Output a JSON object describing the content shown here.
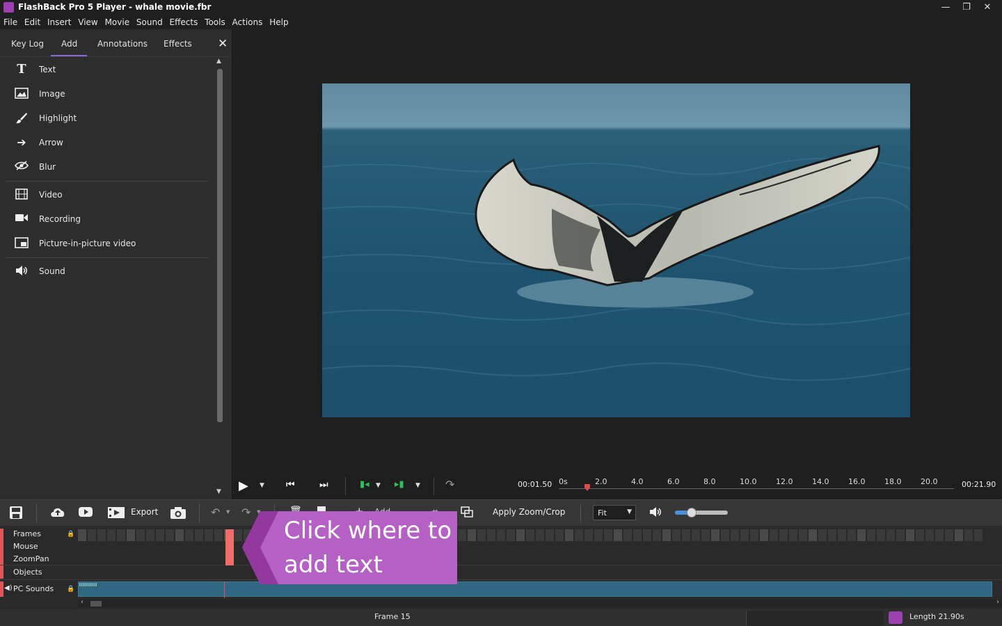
{
  "window": {
    "title": "FlashBack Pro 5 Player - whale movie.fbr"
  },
  "menu": [
    "File",
    "Edit",
    "Insert",
    "View",
    "Movie",
    "Sound",
    "Effects",
    "Tools",
    "Actions",
    "Help"
  ],
  "panel": {
    "tabs": [
      "Key Log",
      "Add",
      "Annotations",
      "Effects"
    ],
    "active_tab": "Add",
    "items": [
      {
        "label": "Text",
        "icon": "text-icon"
      },
      {
        "label": "Image",
        "icon": "image-icon"
      },
      {
        "label": "Highlight",
        "icon": "brush-icon"
      },
      {
        "label": "Arrow",
        "icon": "arrow-icon"
      },
      {
        "label": "Blur",
        "icon": "blur-icon"
      },
      {
        "label": "Video",
        "icon": "film-icon"
      },
      {
        "label": "Recording",
        "icon": "camera-icon"
      },
      {
        "label": "Picture-in-picture video",
        "icon": "pip-icon"
      },
      {
        "label": "Sound",
        "icon": "speaker-icon"
      }
    ]
  },
  "transport": {
    "current_time": "00:01.50",
    "total_time": "00:21.90",
    "ticks": [
      "0s",
      "2.0",
      "4.0",
      "6.0",
      "8.0",
      "10.0",
      "12.0",
      "14.0",
      "16.0",
      "18.0",
      "20.0"
    ],
    "playhead_fraction": 0.072
  },
  "toolbar": {
    "export": "Export",
    "add": "Add",
    "apply_zoom": "Apply Zoom/Crop",
    "zoom_value": "Fit",
    "volume_fraction": 0.32
  },
  "tracks": {
    "frames": "Frames",
    "mouse": "Mouse",
    "zoompan": "ZoomPan",
    "objects": "Objects",
    "pc_sounds": "PC Sounds"
  },
  "callout": {
    "line1": "Click where to",
    "line2": "add text"
  },
  "status": {
    "frame": "Frame 15",
    "length": "Length 21.90s"
  },
  "colors": {
    "accent": "#8a6bd6",
    "callout": "#b560c4",
    "playhead": "#e14b4b",
    "sound_track": "#2f6680"
  }
}
